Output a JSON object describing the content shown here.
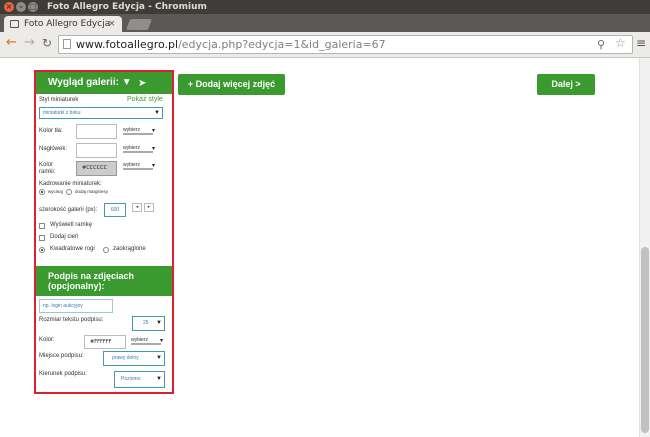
{
  "window": {
    "title": "Foto Allegro Edycja - Chromium"
  },
  "tab": {
    "label": "Foto Allegro Edycja"
  },
  "address": {
    "host": "www.fotoallegro.pl",
    "path": "/edycja.php?edycja=1&id_galeria=67"
  },
  "toolbar_buttons": {
    "add_photos": "+ Dodaj więcej zdjęć",
    "next": "Dalej >"
  },
  "gallery": {
    "header": "Wygląd galerii: ▼",
    "style_label": "Styl miniaturek",
    "show_style": "Pokaż style",
    "style_value": "miniaturki z boku",
    "bg_label": "Kolor tła:",
    "header_label": "Nagłówek:",
    "frame_label_1": "Kolor",
    "frame_label_2": "ramki:",
    "frame_value": "#CCCCCC",
    "choose": "wybierz",
    "crop_label": "Kadrowanie miniaturek:",
    "crop_opt1": "wycinaj",
    "crop_opt2": "dodaj marginesy",
    "width_label": "szerokość galerii (px):",
    "width_value": "600",
    "show_frame": "Wyświetl ramkę",
    "add_shadow": "Dodaj cień",
    "corners_square": "Kwadratowe rogi",
    "corners_round": "zaokrąglone"
  },
  "captions": {
    "header_1": "Podpis na zdjęciach",
    "header_2": "(opcjonalny):",
    "placeholder": "np. login aukcyjny",
    "size_label": "Rozmiar tekstu podpisu:",
    "size_value": "25",
    "color_label": "Kolor:",
    "color_value": "#FFFFFF",
    "choose": "wybierz",
    "place_label": "Miejsce podpisu:",
    "place_value": "prawy dolny",
    "direction_label": "Kierunek podpisu:",
    "direction_value": "Poziomo"
  }
}
